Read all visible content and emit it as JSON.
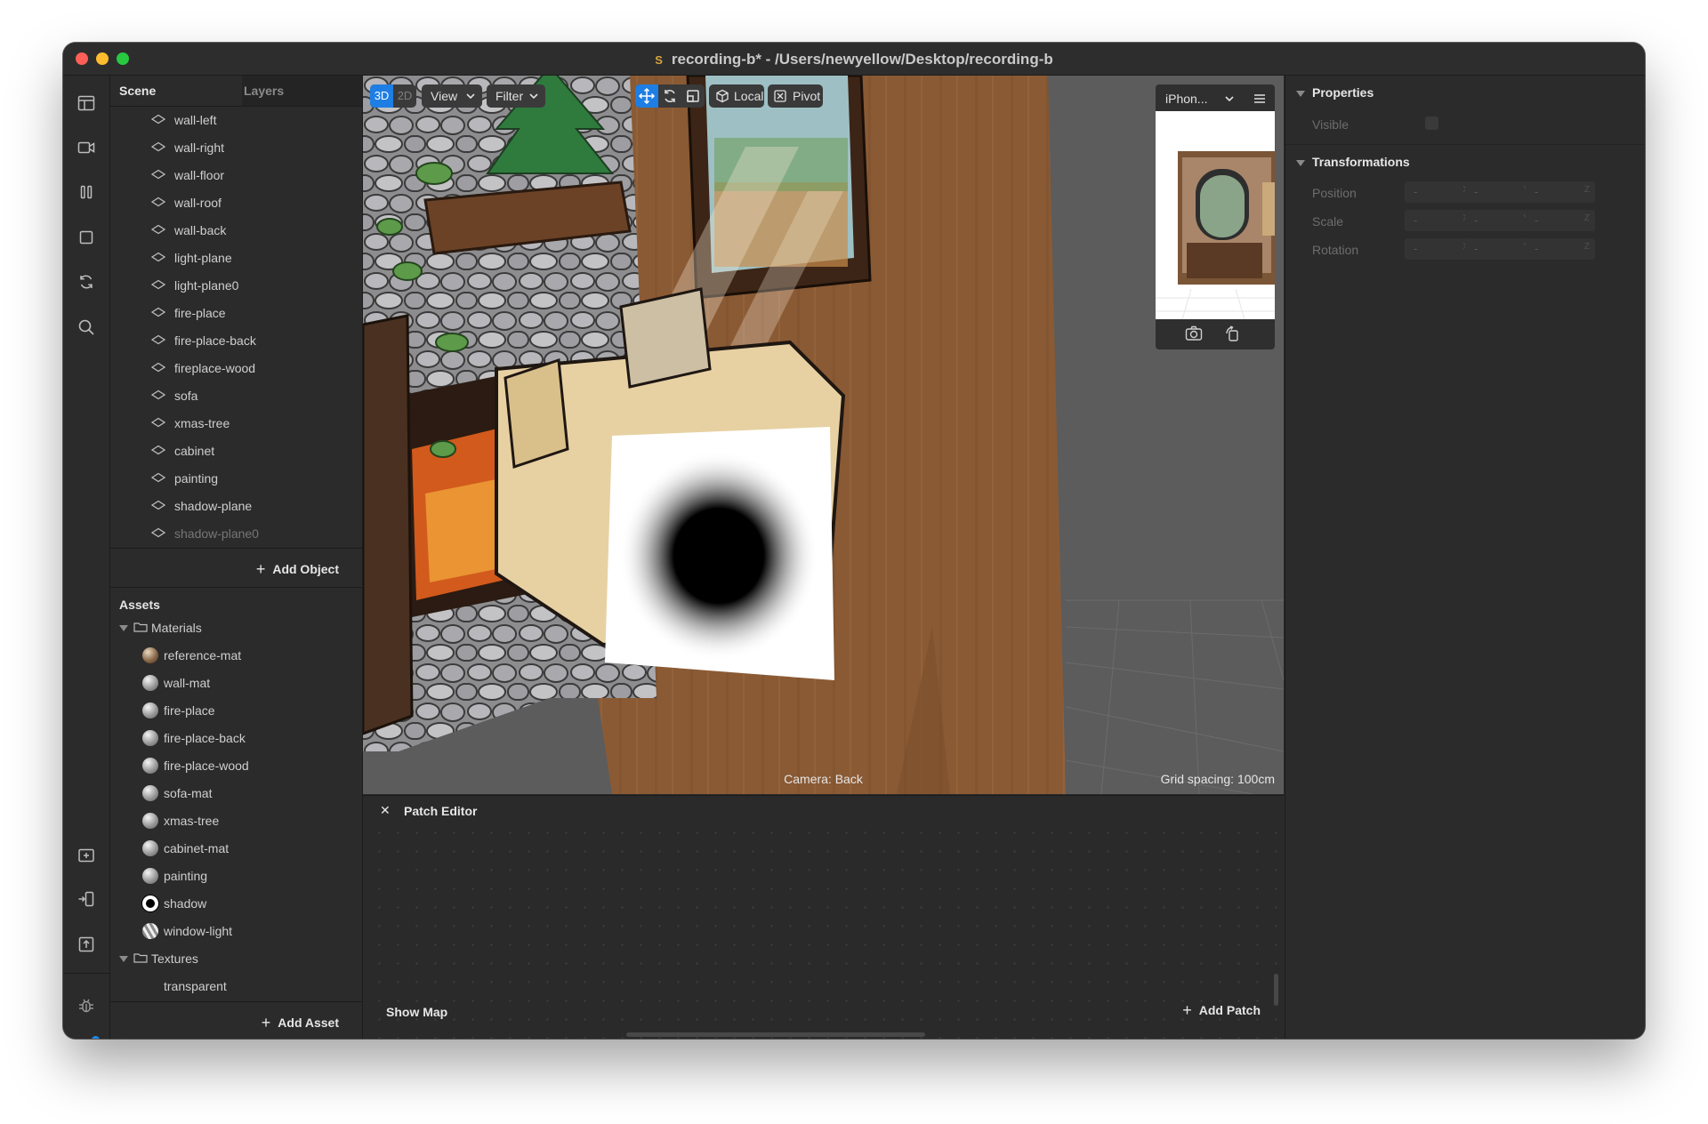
{
  "window": {
    "title": "recording-b* - /Users/newyellow/Desktop/recording-b"
  },
  "toolbar_icons": [
    "layout-icon",
    "video-icon",
    "pause-icon",
    "square-icon",
    "refresh-icon",
    "search-icon",
    "add-folder-icon",
    "import-icon",
    "upload-icon",
    "bug-icon",
    "compare-icon"
  ],
  "scene_panel": {
    "tabs": [
      "Scene",
      "Layers"
    ],
    "items": [
      {
        "label": "wall-left"
      },
      {
        "label": "wall-right"
      },
      {
        "label": "wall-floor"
      },
      {
        "label": "wall-roof"
      },
      {
        "label": "wall-back"
      },
      {
        "label": "light-plane"
      },
      {
        "label": "light-plane0"
      },
      {
        "label": "fire-place"
      },
      {
        "label": "fire-place-back"
      },
      {
        "label": "fireplace-wood"
      },
      {
        "label": "sofa"
      },
      {
        "label": "xmas-tree"
      },
      {
        "label": "cabinet"
      },
      {
        "label": "painting"
      },
      {
        "label": "shadow-plane"
      },
      {
        "label": "shadow-plane0"
      }
    ],
    "add_object_label": "Add Object"
  },
  "assets_panel": {
    "title": "Assets",
    "folders": [
      {
        "label": "Materials",
        "items": [
          {
            "label": "reference-mat",
            "swatch": "textured"
          },
          {
            "label": "wall-mat",
            "swatch": "grey"
          },
          {
            "label": "fire-place",
            "swatch": "grey"
          },
          {
            "label": "fire-place-back",
            "swatch": "grey"
          },
          {
            "label": "fire-place-wood",
            "swatch": "grey"
          },
          {
            "label": "sofa-mat",
            "swatch": "grey"
          },
          {
            "label": "xmas-tree",
            "swatch": "grey"
          },
          {
            "label": "cabinet-mat",
            "swatch": "grey"
          },
          {
            "label": "painting",
            "swatch": "grey"
          },
          {
            "label": "shadow",
            "swatch": "ring"
          },
          {
            "label": "window-light",
            "swatch": "striped"
          }
        ]
      },
      {
        "label": "Textures",
        "items": [
          {
            "label": "transparent",
            "swatch": "none"
          }
        ]
      }
    ],
    "add_asset_label": "Add Asset"
  },
  "viewport": {
    "mode_3d": "3D",
    "mode_2d": "2D",
    "view_label": "View",
    "filter_label": "Filter",
    "local_label": "Local",
    "pivot_label": "Pivot",
    "camera_label": "Camera: Back",
    "grid_label": "Grid spacing: 100cm",
    "device_label": "iPhon...",
    "accent_color": "#1e7ee4"
  },
  "patch_editor": {
    "title": "Patch Editor",
    "show_map_label": "Show Map",
    "add_patch_label": "Add Patch"
  },
  "properties": {
    "title": "Properties",
    "visible_label": "Visible",
    "transformations_title": "Transformations",
    "rows": [
      {
        "label": "Position",
        "values": [
          "-",
          "-",
          "-"
        ]
      },
      {
        "label": "Scale",
        "values": [
          "-",
          "-",
          "-"
        ]
      },
      {
        "label": "Rotation",
        "values": [
          "-",
          "-",
          "-"
        ]
      }
    ],
    "axes": [
      "X",
      "Y",
      "Z"
    ]
  }
}
